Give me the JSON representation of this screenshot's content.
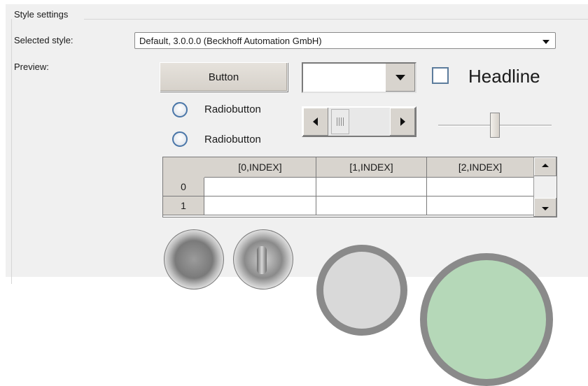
{
  "group": {
    "title": "Style settings"
  },
  "style_selector": {
    "label": "Selected style:",
    "value": "Default, 3.0.0.0 (Beckhoff Automation GmbH)"
  },
  "preview": {
    "label": "Preview:",
    "button_label": "Button",
    "combobox_value": "",
    "checkbox_checked": false,
    "headline": "Headline",
    "radio_buttons": [
      {
        "label": "Radiobutton",
        "checked": false
      },
      {
        "label": "Radiobutton",
        "checked": false
      }
    ],
    "grid": {
      "columns": [
        "[0,INDEX]",
        "[1,INDEX]",
        "[2,INDEX]"
      ],
      "rows": [
        "0",
        "1"
      ]
    }
  },
  "colors": {
    "panel_bg": "#f0f0f0",
    "checkbox_border": "#5c7c9c",
    "radio_border": "#4a76a8",
    "gauge_green": "#b5d8b8"
  }
}
